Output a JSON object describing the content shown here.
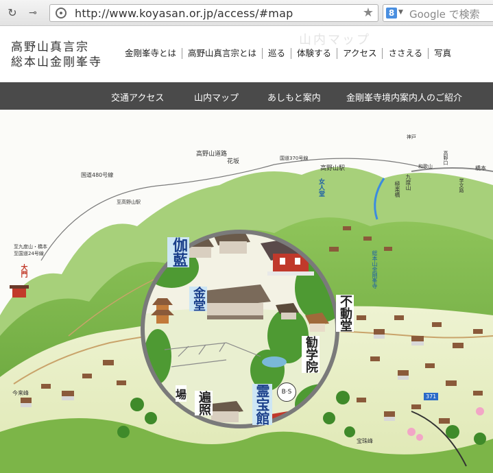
{
  "browser": {
    "url": "http://www.koyasan.or.jp/access/#map",
    "search_placeholder": "Google で検索"
  },
  "site": {
    "logo_line1": "高野山真言宗",
    "logo_line2": "総本山金剛峯寺",
    "ghost_title": "山内マップ"
  },
  "main_nav": [
    {
      "label": "金剛峯寺とは"
    },
    {
      "label": "高野山真言宗とは"
    },
    {
      "label": "巡る"
    },
    {
      "label": "体験する"
    },
    {
      "label": "アクセス"
    },
    {
      "label": "ささえる"
    },
    {
      "label": "写真"
    }
  ],
  "sub_nav": [
    {
      "label": "交通アクセス"
    },
    {
      "label": "山内マップ"
    },
    {
      "label": "あしもと案内"
    },
    {
      "label": "金剛峯寺境内案内人のご紹介"
    }
  ],
  "map": {
    "labels": {
      "koyasan_road": "高野山道路",
      "hanasaka": "花坂",
      "route370": "国道370号線",
      "route480": "国道480号線",
      "koyasan_station": "高野山駅",
      "kudoyama": "九度山",
      "gokuraku": "極楽橋",
      "kobe": "神戸",
      "wakayama": "和歌山",
      "koya_exit": "高野口",
      "hashimoto": "橋本",
      "gakubunro": "学文路",
      "shiko_koyasan_station": "至高野山駅",
      "jingu": "至九度山・橋本",
      "route24": "至国道24号線",
      "daimon": "大門",
      "imaraihou": "今来峰",
      "nyonindo": "女人堂",
      "sokonkai": "総本山金剛峯寺",
      "fudodo": "不動堂",
      "kangakuin": "勧学院",
      "reihokan": "霊宝館",
      "garan": "伽藍",
      "kondo": "金堂",
      "henjo": "遍照",
      "ba": "場",
      "bs": "B·S",
      "route371": "371",
      "hokyomine": "宝珠峰"
    }
  }
}
